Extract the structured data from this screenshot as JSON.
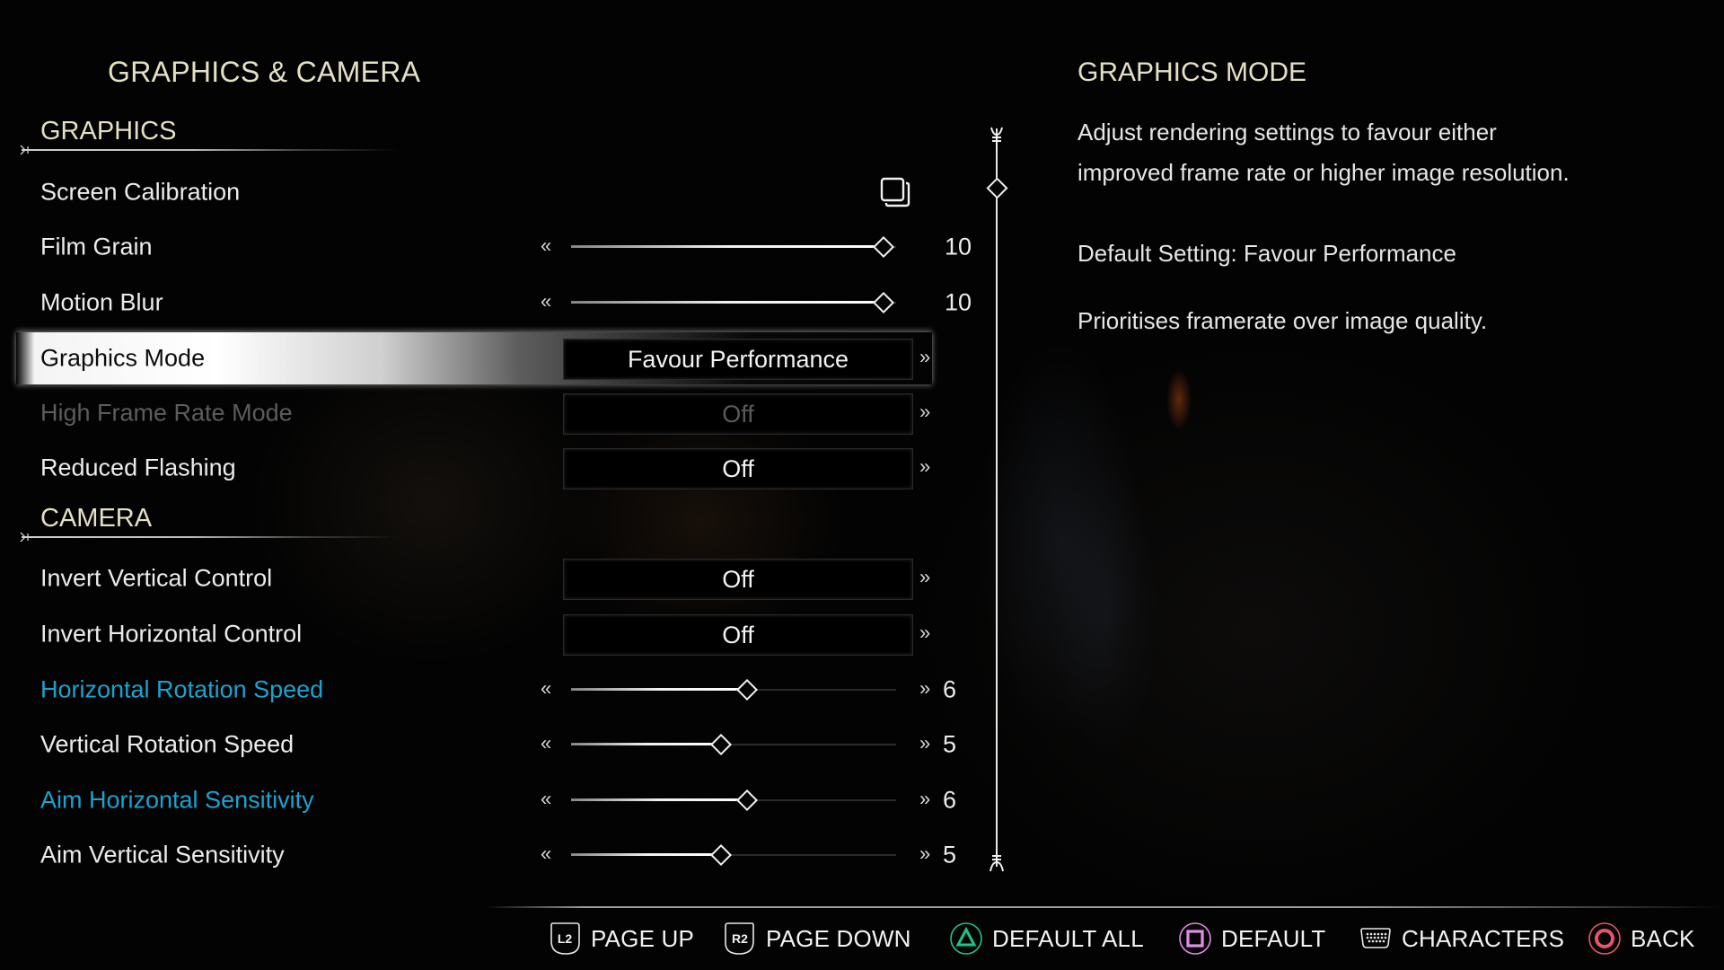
{
  "page_title": "GRAPHICS & CAMERA",
  "colors": {
    "header_gold": "#e4e0c4",
    "accent_blue": "#1aa3cf",
    "dim_text": "#5c5c5c",
    "triangle_green": "#1fc48a",
    "square_pink": "#e48ce8",
    "circle_red": "#e8546a"
  },
  "sections": {
    "graphics": {
      "title": "GRAPHICS",
      "items": [
        {
          "label": "Screen Calibration",
          "type": "action",
          "icon": "copy-screens-icon"
        },
        {
          "label": "Film Grain",
          "type": "slider",
          "value": "10",
          "level": 10,
          "max": 10
        },
        {
          "label": "Motion Blur",
          "type": "slider",
          "value": "10",
          "level": 10,
          "max": 10
        },
        {
          "label": "Graphics Mode",
          "type": "toggle",
          "value": "Favour Performance",
          "selected": true
        },
        {
          "label": "High Frame Rate Mode",
          "type": "toggle",
          "value": "Off",
          "disabled": true
        },
        {
          "label": "Reduced Flashing",
          "type": "toggle",
          "value": "Off"
        }
      ]
    },
    "camera": {
      "title": "CAMERA",
      "items": [
        {
          "label": "Invert Vertical Control",
          "type": "toggle",
          "value": "Off"
        },
        {
          "label": "Invert Horizontal Control",
          "type": "toggle",
          "value": "Off"
        },
        {
          "label": "Horizontal Rotation Speed",
          "type": "slider",
          "value": "6",
          "level": 6,
          "max": 10,
          "modified": true
        },
        {
          "label": "Vertical Rotation Speed",
          "type": "slider",
          "value": "5",
          "level": 5,
          "max": 10
        },
        {
          "label": "Aim Horizontal Sensitivity",
          "type": "slider",
          "value": "6",
          "level": 6,
          "max": 10,
          "modified": true
        },
        {
          "label": "Aim Vertical Sensitivity",
          "type": "slider",
          "value": "5",
          "level": 5,
          "max": 10
        }
      ]
    }
  },
  "chevrons": {
    "left": "«",
    "right": "»"
  },
  "scroll_position": 0.0,
  "detail_panel": {
    "title": "GRAPHICS MODE",
    "description_line1": "Adjust rendering settings to favour either",
    "description_line2": "improved frame rate or higher image resolution.",
    "default_setting": "Default Setting: Favour Performance",
    "note": "Prioritises framerate over image quality."
  },
  "footer": [
    {
      "button": "L2",
      "icon": "l2-trigger-icon",
      "label": "PAGE UP"
    },
    {
      "button": "R2",
      "icon": "r2-trigger-icon",
      "label": "PAGE DOWN"
    },
    {
      "button": "Triangle",
      "icon": "triangle-button-icon",
      "label": "DEFAULT ALL"
    },
    {
      "button": "Square",
      "icon": "square-button-icon",
      "label": "DEFAULT"
    },
    {
      "button": "Touchpad",
      "icon": "touchpad-icon",
      "label": "CHARACTERS"
    },
    {
      "button": "Circle",
      "icon": "circle-button-icon",
      "label": "BACK"
    }
  ]
}
